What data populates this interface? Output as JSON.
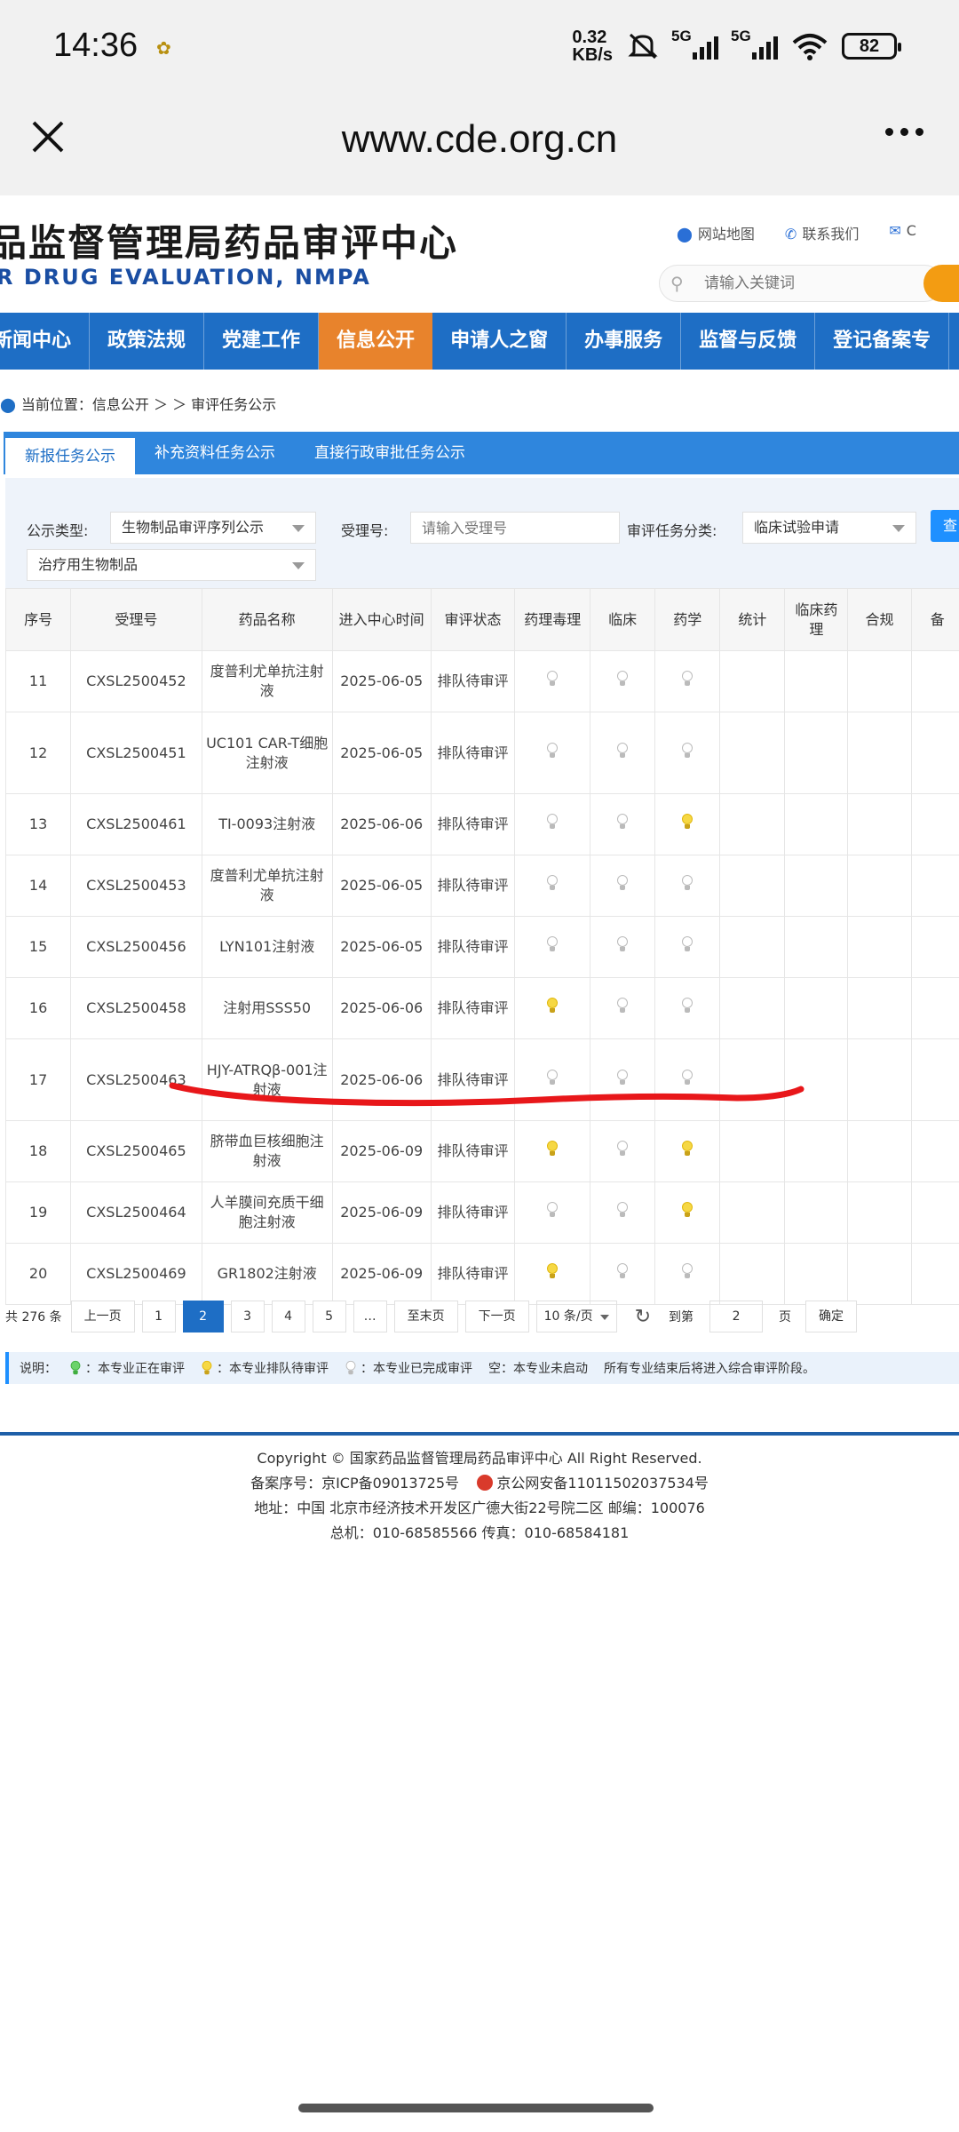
{
  "status": {
    "time": "14:36",
    "speed_value": "0.32",
    "speed_unit": "KB/s",
    "net1": "5G",
    "net2": "5G",
    "battery": "82"
  },
  "browser": {
    "url": "www.cde.org.cn"
  },
  "header": {
    "title_cn": "品监督管理局药品审评中心",
    "title_en": "R DRUG EVALUATION, NMPA",
    "links": [
      "网站地图",
      "联系我们",
      "C"
    ],
    "search_placeholder": "请输入关键词"
  },
  "nav": {
    "items": [
      "新闻中心",
      "政策法规",
      "党建工作",
      "信息公开",
      "申请人之窗",
      "办事服务",
      "监督与反馈",
      "登记备案专"
    ],
    "active_index": 3
  },
  "breadcrumb": {
    "label": "当前位置：信息公开 ＞ ＞ 审评任务公示"
  },
  "subtabs": [
    "新报任务公示",
    "补充资料任务公示",
    "直接行政审批任务公示"
  ],
  "filter": {
    "type_label": "公示类型:",
    "type_value": "生物制品审评序列公示",
    "accept_label": "受理号:",
    "accept_placeholder": "请输入受理号",
    "category_label": "审评任务分类:",
    "category_value": "临床试验申请",
    "sub_value": "治疗用生物制品",
    "query_label": "查"
  },
  "table": {
    "headers": [
      "序号",
      "受理号",
      "药品名称",
      "进入中心时间",
      "审评状态",
      "药理毒理",
      "临床",
      "药学",
      "统计",
      "临床药理",
      "合规",
      "备"
    ],
    "rows": [
      {
        "no": "11",
        "id": "CXSL2500452",
        "name": "度普利尤单抗注射液",
        "date": "2025-06-05",
        "status": "排队待审评",
        "lights": [
          "w",
          "w",
          "w"
        ]
      },
      {
        "no": "12",
        "id": "CXSL2500451",
        "name": "UC101 CAR-T细胞注射液",
        "date": "2025-06-05",
        "status": "排队待审评",
        "lights": [
          "w",
          "w",
          "w"
        ]
      },
      {
        "no": "13",
        "id": "CXSL2500461",
        "name": "TI-0093注射液",
        "date": "2025-06-06",
        "status": "排队待审评",
        "lights": [
          "w",
          "w",
          "y"
        ]
      },
      {
        "no": "14",
        "id": "CXSL2500453",
        "name": "度普利尤单抗注射液",
        "date": "2025-06-05",
        "status": "排队待审评",
        "lights": [
          "w",
          "w",
          "w"
        ]
      },
      {
        "no": "15",
        "id": "CXSL2500456",
        "name": "LYN101注射液",
        "date": "2025-06-05",
        "status": "排队待审评",
        "lights": [
          "w",
          "w",
          "w"
        ]
      },
      {
        "no": "16",
        "id": "CXSL2500458",
        "name": "注射用SSS50",
        "date": "2025-06-06",
        "status": "排队待审评",
        "lights": [
          "y",
          "w",
          "w"
        ]
      },
      {
        "no": "17",
        "id": "CXSL2500463",
        "name": "HJY-ATRQβ-001注射液",
        "date": "2025-06-06",
        "status": "排队待审评",
        "lights": [
          "w",
          "w",
          "w"
        ]
      },
      {
        "no": "18",
        "id": "CXSL2500465",
        "name": "脐带血巨核细胞注射液",
        "date": "2025-06-09",
        "status": "排队待审评",
        "lights": [
          "y",
          "w",
          "y"
        ]
      },
      {
        "no": "19",
        "id": "CXSL2500464",
        "name": "人羊膜间充质干细胞注射液",
        "date": "2025-06-09",
        "status": "排队待审评",
        "lights": [
          "w",
          "w",
          "y"
        ]
      },
      {
        "no": "20",
        "id": "CXSL2500469",
        "name": "GR1802注射液",
        "date": "2025-06-09",
        "status": "排队待审评",
        "lights": [
          "y",
          "w",
          "w"
        ]
      }
    ]
  },
  "pager": {
    "total": "共 276 条",
    "prev": "上一页",
    "pages": [
      "1",
      "2",
      "3",
      "4",
      "5",
      "…"
    ],
    "current": "2",
    "last": "至末页",
    "next": "下一页",
    "page_size": "10 条/页",
    "goto_label": "到第",
    "goto_value": "2",
    "page_unit": "页",
    "confirm": "确定"
  },
  "legend": {
    "prefix": "说明：",
    "items": [
      "本专业正在审评",
      "本专业排队待审评",
      "本专业已完成审评"
    ],
    "empty_note": "空：本专业未启动",
    "final_note": "所有专业结束后将进入综合审评阶段。"
  },
  "footer": {
    "copyright": "Copyright © 国家药品监督管理局药品审评中心    All Right Reserved.",
    "icp": "备案序号：京ICP备09013725号",
    "police": "京公网安备11011502037534号",
    "address": "地址：中国 北京市经济技术开发区广德大街22号院二区      邮编：100076",
    "phone": "总机：010-68585566      传真：010-68584181"
  },
  "colors": {
    "nav_blue": "#1e6ec5",
    "nav_active": "#e8832c",
    "annotation_red": "#e8171a"
  }
}
